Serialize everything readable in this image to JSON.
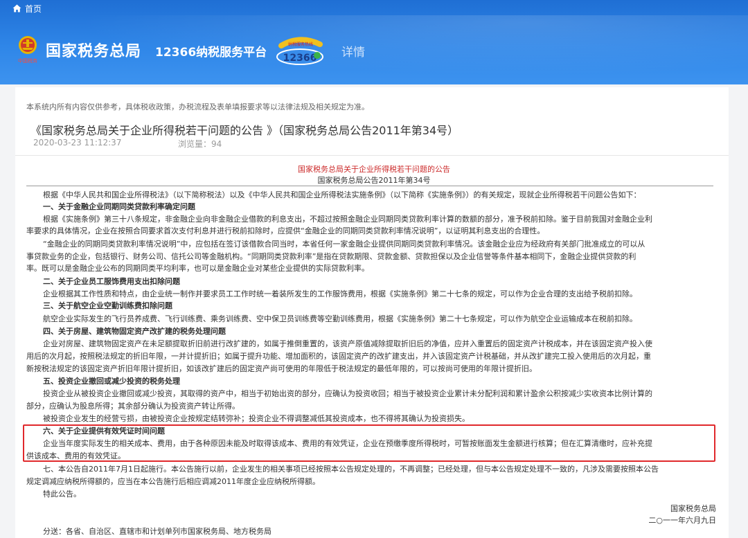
{
  "nav": {
    "home_label": "首页"
  },
  "brand": {
    "title": "国家税务总局",
    "platform": "12366纳税服务平台",
    "badge_number": "12366",
    "badge_caption": "纳税服务热线",
    "emblem_caption": "中国税务",
    "detail_label": "详情"
  },
  "article": {
    "disclaimer": "本系统内所有内容仅供参考，具体税收政策，办税流程及表单填报要求等以法律法规及相关规定为准。",
    "title": "《国家税务总局关于企业所得税若干问题的公告 》（国家税务总局公告2011年第34号）",
    "date": "2020-03-23 11:12:37",
    "views": "浏览量：94",
    "doc_heading": "国家税务总局关于企业所得税若干问题的公告",
    "doc_number": "国家税务总局公告2011年第34号",
    "lines": [
      "根据《中华人民共和国企业所得税法》（以下简称税法）以及《中华人民共和国企业所得税法实施条例》（以下简称《实施条例》）的有关规定，现就企业所得税若干问题公告如下：",
      "一、关于金融企业同期同类贷款利率确定问题",
      "根据《实施条例》第三十八条规定，非金融企业向非金融企业借款的利息支出，不超过按照金融企业同期同类贷款利率计算的数额的部分，准予税前扣除。鉴于目前我国对金融企业利",
      "率要求的具体情况，企业在按照合同要求首次支付利息并进行税前扣除时，应提供“金融企业的同期同类贷款利率情况说明”，以证明其利息支出的合理性。",
      "“金融企业的同期同类贷款利率情况说明”中，应包括在签订该借款合同当时，本省任何一家金融企业提供同期同类贷款利率情况。该金融企业应为经政府有关部门批准成立的可以从",
      "事贷款业务的企业，包括银行、财务公司、信托公司等金融机构。“同期同类贷款利率”是指在贷款期限、贷款金额、贷款担保以及企业信誉等条件基本相同下，金融企业提供贷款的利",
      "率。既可以是金融企业公布的同期同类平均利率，也可以是金融企业对某些企业提供的实际贷款利率。",
      "二、关于企业员工服饰费用支出扣除问题",
      "企业根据其工作性质和特点，由企业统一制作并要求员工工作时统一着装所发生的工作服饰费用，根据《实施条例》第二十七条的规定，可以作为企业合理的支出给予税前扣除。",
      "三、关于航空企业空勤训练费扣除问题",
      "航空企业实际发生的飞行员养成费、飞行训练费、乘务训练费、空中保卫员训练费等空勤训练费用，根据《实施条例》第二十七条规定，可以作为航空企业运输成本在税前扣除。",
      "四、关于房屋、建筑物固定资产改扩建的税务处理问题",
      "企业对房屋、建筑物固定资产在未足额提取折旧前进行改扩建的，如属于推倒重置的，该资产原值减除提取折旧后的净值，应并入重置后的固定资产计税成本，并在该固定资产投入使",
      "用后的次月起，按照税法规定的折旧年限，一并计提折旧；如属于提升功能、增加面积的，该固定资产的改扩建支出，并入该固定资产计税基础，并从改扩建完工投入使用后的次月起，重",
      "新按税法规定的该固定资产折旧年限计提折旧，如该改扩建后的固定资产尚可使用的年限低于税法规定的最低年限的，可以按尚可使用的年限计提折旧。",
      "五、投资企业撤回或减少投资的税务处理",
      "投资企业从被投资企业撤回或减少投资，其取得的资产中，相当于初始出资的部分，应确认为投资收回；相当于被投资企业累计未分配利润和累计盈余公积按减少实收资本比例计算的",
      "部分，应确认为股息所得；其余部分确认为投资资产转让所得。",
      "被投资企业发生的经营亏损，由被投资企业按规定结转弥补；投资企业不得调整减低其投资成本，也不得将其确认为投资损失。",
      "六、关于企业提供有效凭证时间问题",
      "企业当年度实际发生的相关成本、费用，由于各种原因未能及时取得该成本、费用的有效凭证，企业在预缴季度所得税时，可暂按账面发生金额进行核算；但在汇算清缴时，应补充提",
      "供该成本、费用的有效凭证。",
      "七、本公告自2011年7月1日起施行。本公告施行以前，企业发生的相关事项已经按照本公告规定处理的，不再调整；已经处理，但与本公告规定处理不一致的，凡涉及需要按照本公告",
      "规定调减应纳税所得额的，应当在本公告施行后相应调减2011年度企业应纳税所得额。",
      "特此公告。"
    ],
    "signature_org": "国家税务总局",
    "signature_date": "二○一一年六月九日",
    "distribution": "分送：各省、自治区、直辖市和计划单列市国家税务局、地方税务局"
  },
  "colors": {
    "header_blue": "#2a7fe0",
    "doc_heading_red": "#cc2b2b",
    "highlight_red": "#e0282b"
  }
}
